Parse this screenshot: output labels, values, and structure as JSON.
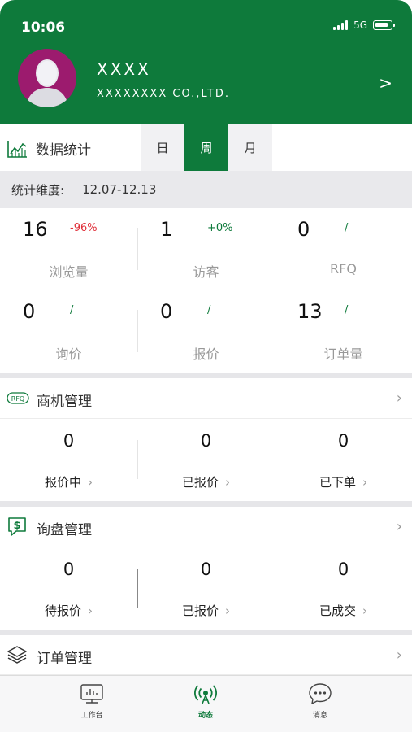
{
  "status_bar": {
    "time": "10:06",
    "network": "5G"
  },
  "profile": {
    "name": "XXXX",
    "company": "XXXXXXXX CO.,LTD.",
    "chevron": ">"
  },
  "stats": {
    "title": "数据统计",
    "tabs": [
      {
        "label": "日",
        "active": false
      },
      {
        "label": "周",
        "active": true
      },
      {
        "label": "月",
        "active": false
      }
    ],
    "dimension_label": "统计维度:",
    "dimension_value": "12.07-12.13",
    "metrics": [
      {
        "value": "16",
        "change": "-96%",
        "label": "浏览量"
      },
      {
        "value": "1",
        "change": "+0%",
        "label": "访客"
      },
      {
        "value": "0",
        "change": "/",
        "label": "RFQ"
      },
      {
        "value": "0",
        "change": "/",
        "label": "询价"
      },
      {
        "value": "0",
        "change": "/",
        "label": "报价"
      },
      {
        "value": "13",
        "change": "/",
        "label": "订单量"
      }
    ]
  },
  "opportunity": {
    "icon_text": "RFQ",
    "title": "商机管理",
    "items": [
      {
        "value": "0",
        "label": "报价中"
      },
      {
        "value": "0",
        "label": "已报价"
      },
      {
        "value": "0",
        "label": "已下单"
      }
    ]
  },
  "inquiry": {
    "title": "询盘管理",
    "items": [
      {
        "value": "0",
        "label": "待报价"
      },
      {
        "value": "0",
        "label": "已报价"
      },
      {
        "value": "0",
        "label": "已成交"
      }
    ]
  },
  "orders": {
    "title": "订单管理"
  },
  "bottom_nav": [
    {
      "label": "工作台",
      "icon": "workbench-icon",
      "active": false
    },
    {
      "label": "动态",
      "icon": "broadcast-icon",
      "active": true
    },
    {
      "label": "消息",
      "icon": "message-icon",
      "active": false
    }
  ],
  "colors": {
    "brand": "#0e7a3b",
    "negative": "#e0303a",
    "avatar_bg": "#9c1b6e"
  }
}
